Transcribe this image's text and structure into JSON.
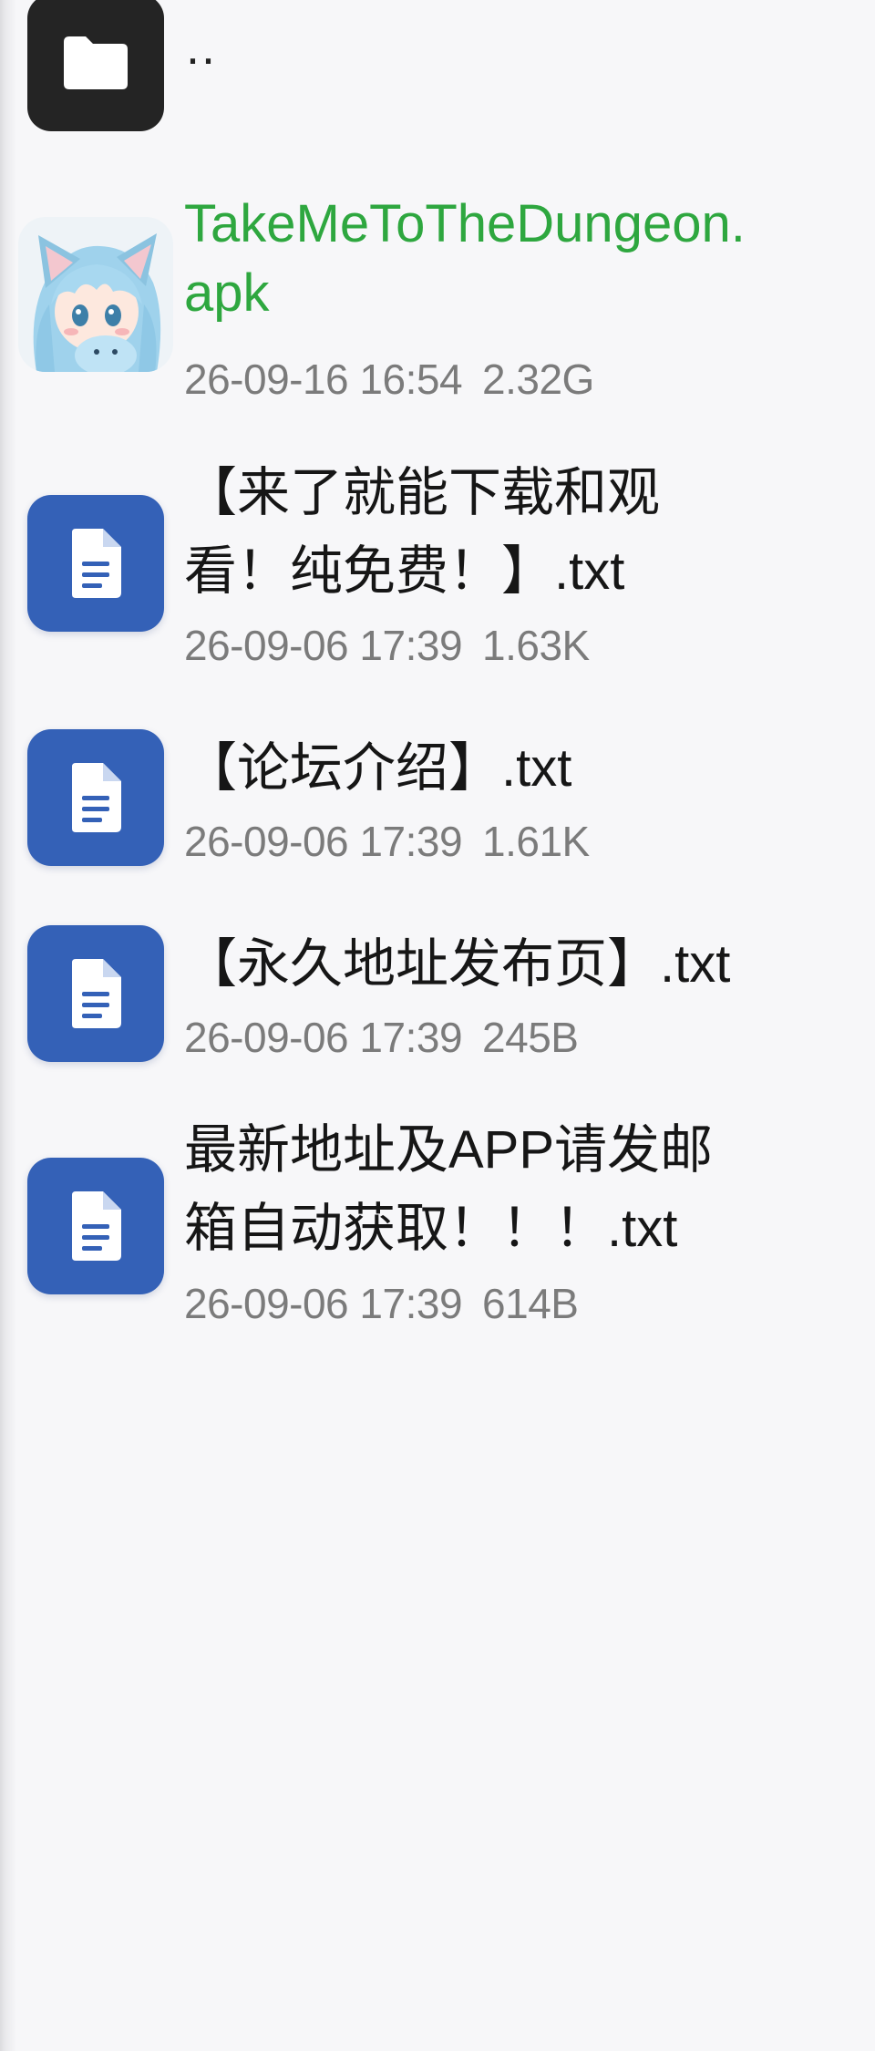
{
  "colors": {
    "background": "#f7f7f9",
    "apk_name": "#2ea73f",
    "file_name": "#161616",
    "meta": "#7b7b7b",
    "folder_icon_bg": "#242424",
    "doc_icon_bg": "#3461b7"
  },
  "parent_dir": {
    "label": "..",
    "icon": "folder-icon"
  },
  "files": [
    {
      "icon": "app-thumbnail",
      "name_lines": [
        "TakeMeToTheDungeon.",
        "apk"
      ],
      "date": "26-09-16 16:54",
      "size": "2.32G"
    },
    {
      "icon": "document-icon",
      "name_lines": [
        "【来了就能下载和观",
        "看！纯免费！】.txt"
      ],
      "date": "26-09-06 17:39",
      "size": "1.63K"
    },
    {
      "icon": "document-icon",
      "name_lines": [
        "【论坛介绍】.txt"
      ],
      "date": "26-09-06 17:39",
      "size": "1.61K"
    },
    {
      "icon": "document-icon",
      "name_lines": [
        "【永久地址发布页】.txt"
      ],
      "date": "26-09-06 17:39",
      "size": "245B"
    },
    {
      "icon": "document-icon",
      "name_lines": [
        "最新地址及APP请发邮",
        "箱自动获取！！！.txt"
      ],
      "date": "26-09-06 17:39",
      "size": "614B"
    }
  ]
}
